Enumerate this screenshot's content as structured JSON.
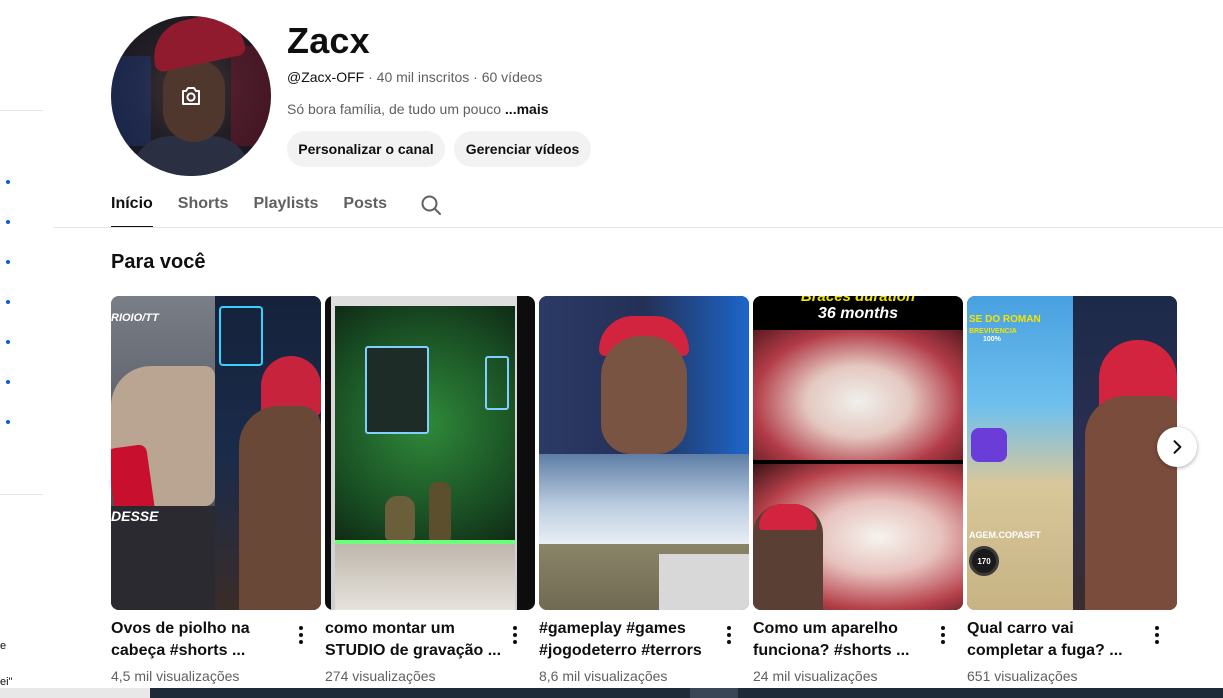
{
  "channel": {
    "name": "Zacx",
    "handle": "@Zacx-OFF",
    "separator": "·",
    "subscribers": "40 mil inscritos",
    "videos": "60 vídeos",
    "description": "Só bora família, de tudo um pouco",
    "more_label": "...mais",
    "customize_button": "Personalizar o canal",
    "manage_button": "Gerenciar vídeos"
  },
  "tabs": [
    {
      "label": "Início",
      "active": true
    },
    {
      "label": "Shorts",
      "active": false
    },
    {
      "label": "Playlists",
      "active": false
    },
    {
      "label": "Posts",
      "active": false
    }
  ],
  "section": {
    "title": "Para você"
  },
  "shorts": [
    {
      "title_line1": "Ovos de piolho na",
      "title_line2": "cabeça #shorts ...",
      "views": "4,5 mil visualizações",
      "overlay_top": "RIOIO/TT",
      "overlay_mid": "DESSE"
    },
    {
      "title_line1": "como montar um",
      "title_line2": "STUDIO de gravação ...",
      "views": "274 visualizações"
    },
    {
      "title_line1": "#gameplay #games",
      "title_line2": "#jogodeterro #terrors",
      "views": "8,6 mil visualizações"
    },
    {
      "title_line1": "Como um aparelho",
      "title_line2": "funciona? #shorts ...",
      "views": "24 mil visualizações",
      "overlay_top": "Braces duration",
      "overlay_sub": "36 months"
    },
    {
      "title_line1": "Qual carro vai",
      "title_line2": "completar a fuga? ...",
      "views": "651 visualizações",
      "overlay_top": "SE DO ROMAN",
      "overlay_sub": "BREVIVENCIA",
      "overlay_pct": "100%",
      "overlay_low": "AGEM.COPASFT",
      "overlay_speed": "170"
    }
  ],
  "sidebar_stray_text": [
    "e",
    "ei\""
  ],
  "colors": {
    "accent_blue": "#065fd4",
    "chip_bg": "#f2f2f2",
    "text_primary": "#0f0f0f",
    "text_secondary": "#606060"
  },
  "icons": [
    "camera-icon",
    "search-icon",
    "more-vert-icon",
    "chevron-right-icon"
  ]
}
